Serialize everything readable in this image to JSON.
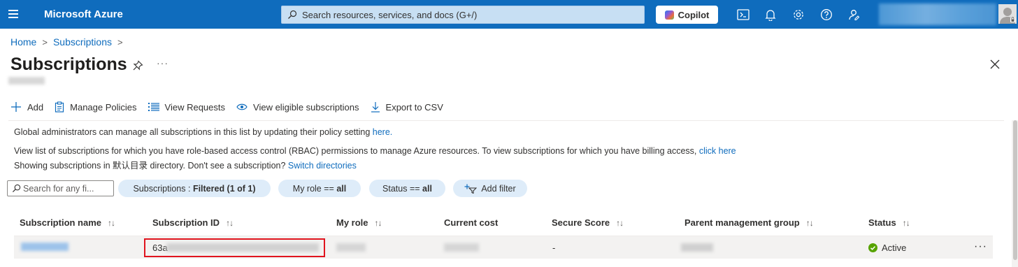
{
  "app": {
    "brand": "Microsoft Azure"
  },
  "search": {
    "placeholder": "Search resources, services, and docs (G+/)"
  },
  "copilot": {
    "label": "Copilot"
  },
  "breadcrumb": {
    "home": "Home",
    "subscriptions": "Subscriptions",
    "separator": ">"
  },
  "page": {
    "title": "Subscriptions",
    "more": "···"
  },
  "commands": {
    "add": "Add",
    "manage_policies": "Manage Policies",
    "view_requests": "View Requests",
    "view_eligible": "View eligible subscriptions",
    "export_csv": "Export to CSV"
  },
  "info": {
    "line1_text": "Global administrators can manage all subscriptions in this list by updating their policy setting ",
    "line1_link": "here.",
    "line2_text": "View list of subscriptions for which you have role-based access control (RBAC) permissions to manage Azure resources. To view subscriptions for which you have billing access, ",
    "line2_link": "click here",
    "line3_text": "Showing subscriptions in 默认目录 directory. Don't see a subscription? ",
    "line3_link": "Switch directories"
  },
  "filters": {
    "search_placeholder": "Search for any fi...",
    "subscriptions_label": "Subscriptions : ",
    "subscriptions_value": "Filtered (1 of 1)",
    "role_label": "My role == ",
    "role_value": "all",
    "status_label": "Status == ",
    "status_value": "all",
    "add_filter": "Add filter"
  },
  "table": {
    "columns": [
      "Subscription name",
      "Subscription ID",
      "My role",
      "Current cost",
      "Secure Score",
      "Parent management group",
      "Status"
    ],
    "sort_glyph": "↑↓",
    "rows": [
      {
        "subscription_id_prefix": "63a",
        "secure_score": "-",
        "status": "Active",
        "more": "···"
      }
    ]
  },
  "colors": {
    "accent": "#0f6cbd",
    "pill_bg": "#deecf9",
    "highlight_border": "#e0141e",
    "status_active": "#57a300"
  }
}
